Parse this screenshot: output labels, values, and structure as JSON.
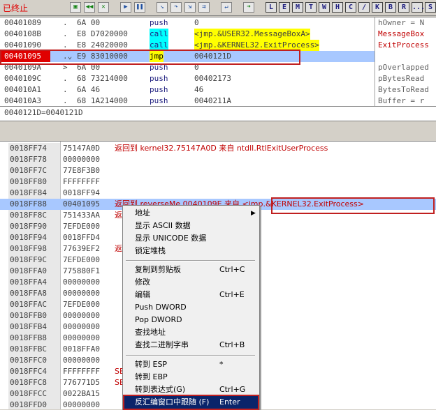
{
  "toolbar": {
    "status": "已终止",
    "letters": [
      "L",
      "E",
      "M",
      "T",
      "W",
      "H",
      "C",
      "/",
      "K",
      "B",
      "R",
      "...",
      "S"
    ]
  },
  "disasm": {
    "rows": [
      {
        "addr": "00401089",
        "mark": ".",
        "hex": "6A 00",
        "mn": "push",
        "op": "0"
      },
      {
        "addr": "0040108B",
        "mark": ".",
        "hex": "E8 D7020000",
        "mn": "call",
        "op": "<jmp.&USER32.MessageBoxA>"
      },
      {
        "addr": "00401090",
        "mark": ".",
        "hex": "E8 24020000",
        "mn": "call",
        "op": "<jmp.&KERNEL32.ExitProcess>"
      },
      {
        "addr": "00401095",
        "mark": ".⌄",
        "hex": "E9 83010000",
        "mn": "jmp",
        "op": "0040121D"
      },
      {
        "addr": "0040109A",
        "mark": ">",
        "hex": "6A 00",
        "mn": "push",
        "op": "0"
      },
      {
        "addr": "0040109C",
        "mark": ".",
        "hex": "68 73214000",
        "mn": "push",
        "op": "00402173"
      },
      {
        "addr": "004010A1",
        "mark": ".",
        "hex": "6A 46",
        "mn": "push",
        "op": "46"
      },
      {
        "addr": "004010A3",
        "mark": ".",
        "hex": "68 1A214000",
        "mn": "push",
        "op": "0040211A"
      }
    ],
    "comments": [
      "hOwner = N",
      "MessageBox",
      "ExitProcess",
      "",
      "pOverlapped",
      "pBytesRead",
      "BytesToRead",
      "Buffer = r"
    ]
  },
  "info_line": "0040121D=0040121D",
  "stack": {
    "rows": [
      {
        "addr": "0018FF74",
        "val": "75147A0D",
        "comment": "返回到 kernel32.75147A0D 来自 ntdll.RtlExitUserProcess"
      },
      {
        "addr": "0018FF78",
        "val": "00000000",
        "comment": ""
      },
      {
        "addr": "0018FF7C",
        "val": "77E8F3B0",
        "comment": ""
      },
      {
        "addr": "0018FF80",
        "val": "FFFFFFFF",
        "comment": ""
      },
      {
        "addr": "0018FF84",
        "val": "0018FF94",
        "comment": ""
      },
      {
        "addr": "",
        "val": "",
        "comment": ""
      },
      {
        "addr": "0018FF88",
        "val": "00401095",
        "comment": "返回到 reverseMe.0040109E 来自 <jmp.&KERNEL32.ExitProcess>"
      },
      {
        "addr": "0018FF8C",
        "val": "751433AA",
        "comment": "返"
      },
      {
        "addr": "0018FF90",
        "val": "7EFDE000",
        "comment": ""
      },
      {
        "addr": "0018FF94",
        "val": "0018FFD4",
        "comment": ""
      },
      {
        "addr": "0018FF98",
        "val": "77639EF2",
        "comment": "返"
      },
      {
        "addr": "0018FF9C",
        "val": "7EFDE000",
        "comment": ""
      },
      {
        "addr": "0018FFA0",
        "val": "775880F1",
        "comment": ""
      },
      {
        "addr": "0018FFA4",
        "val": "00000000",
        "comment": ""
      },
      {
        "addr": "0018FFA8",
        "val": "00000000",
        "comment": ""
      },
      {
        "addr": "0018FFAC",
        "val": "7EFDE000",
        "comment": ""
      },
      {
        "addr": "0018FFB0",
        "val": "00000000",
        "comment": ""
      },
      {
        "addr": "0018FFB4",
        "val": "00000000",
        "comment": ""
      },
      {
        "addr": "0018FFB8",
        "val": "00000000",
        "comment": ""
      },
      {
        "addr": "0018FFBC",
        "val": "0018FFA0",
        "comment": ""
      },
      {
        "addr": "0018FFC0",
        "val": "00000000",
        "comment": ""
      },
      {
        "addr": "0018FFC4",
        "val": "FFFFFFFF",
        "comment": "SE"
      },
      {
        "addr": "0018FFC8",
        "val": "776771D5",
        "comment": "SE"
      },
      {
        "addr": "0018FFCC",
        "val": "0022BA15",
        "comment": ""
      },
      {
        "addr": "0018FFD0",
        "val": "00000000",
        "comment": ""
      }
    ]
  },
  "context_menu": {
    "items": [
      {
        "label": "地址",
        "shortcut": "",
        "submenu": true
      },
      {
        "label": "显示 ASCII 数据",
        "shortcut": ""
      },
      {
        "label": "显示 UNICODE 数据",
        "shortcut": ""
      },
      {
        "label": "锁定堆栈",
        "shortcut": ""
      },
      {
        "sep": true
      },
      {
        "label": "复制到剪贴板",
        "shortcut": "Ctrl+C"
      },
      {
        "label": "修改",
        "shortcut": ""
      },
      {
        "label": "编辑",
        "shortcut": "Ctrl+E"
      },
      {
        "label": "Push DWORD",
        "shortcut": ""
      },
      {
        "label": "Pop DWORD",
        "shortcut": ""
      },
      {
        "label": "查找地址",
        "shortcut": ""
      },
      {
        "label": "查找二进制字串",
        "shortcut": "Ctrl+B"
      },
      {
        "sep": true
      },
      {
        "label": "转到 ESP",
        "shortcut": "*"
      },
      {
        "label": "转到 EBP",
        "shortcut": ""
      },
      {
        "label": "转到表达式(G)",
        "shortcut": "Ctrl+G"
      },
      {
        "label": "反汇编窗口中跟随 (F)",
        "shortcut": "Enter",
        "active": true
      }
    ]
  }
}
